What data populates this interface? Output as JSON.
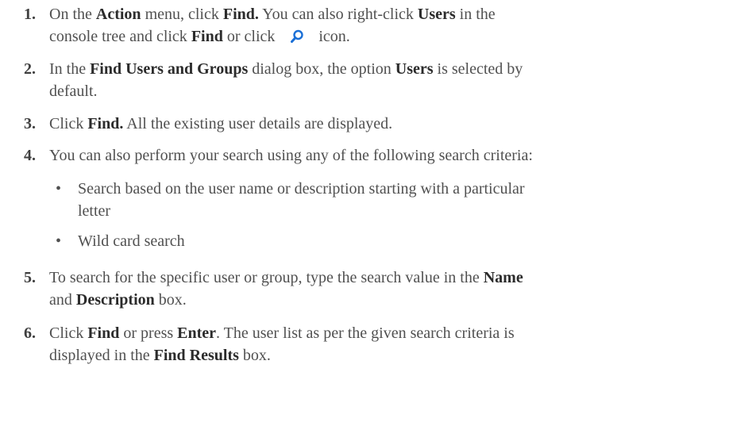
{
  "steps": [
    {
      "num": "1.",
      "parts": [
        "On the ",
        "Action",
        " menu, click ",
        "Find.",
        " You can also right-click ",
        "Users",
        " in the",
        "console tree and click ",
        "Find",
        " or click ",
        "icon."
      ]
    },
    {
      "num": "2.",
      "parts": [
        "In the ",
        "Find Users and Groups",
        " dialog box, the option ",
        "Users",
        " is selected by",
        "default."
      ]
    },
    {
      "num": "3.",
      "parts": [
        "Click ",
        "Find.",
        " All the existing user details are displayed."
      ]
    },
    {
      "num": "4.",
      "parts": [
        "You can also perform your search using any of the following search criteria:"
      ]
    },
    {
      "num": "5.",
      "parts": [
        "To search for the specific user or group, type the search value in the ",
        "Name",
        "and ",
        "Description",
        " box."
      ]
    },
    {
      "num": "6.",
      "parts": [
        "Click ",
        "Find",
        " or press ",
        "Enter",
        ". The user list as per the given search criteria is",
        "displayed in the ",
        "Find Results",
        " box."
      ]
    }
  ],
  "bullets": [
    {
      "mark": "•",
      "lines": [
        "Search based on the user name or description starting with a particular",
        "letter"
      ]
    },
    {
      "mark": "•",
      "lines": [
        "Wild card search"
      ]
    }
  ],
  "icons": {
    "find": "search-icon",
    "accent": "#1a6fd6"
  }
}
